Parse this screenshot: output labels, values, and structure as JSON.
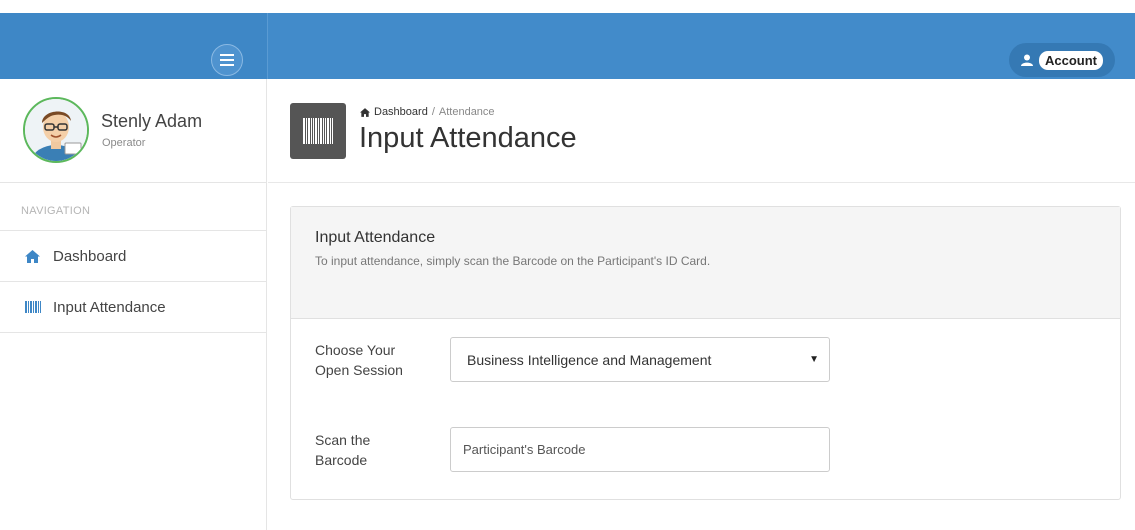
{
  "topbar": {
    "account_label": "Account",
    "colors": {
      "navbar": "#428bca",
      "sidebar_top": "#3e87c6"
    }
  },
  "sidebar": {
    "profile": {
      "name": "Stenly Adam",
      "role": "Operator"
    },
    "nav_heading": "NAVIGATION",
    "items": [
      {
        "label": "Dashboard",
        "icon": "home-icon"
      },
      {
        "label": "Input Attendance",
        "icon": "barcode-icon"
      }
    ]
  },
  "header": {
    "breadcrumb": {
      "home": "Dashboard",
      "separator": "/",
      "current": "Attendance"
    },
    "title": "Input Attendance",
    "icon": "barcode-icon"
  },
  "panel": {
    "title": "Input Attendance",
    "description": "To input attendance, simply scan the Barcode on the Participant's ID Card.",
    "session": {
      "label_line1": "Choose Your",
      "label_line2": "Open Session",
      "selected": "Business Intelligence and Management"
    },
    "barcode": {
      "label_line1": "Scan the",
      "label_line2": "Barcode",
      "placeholder": "Participant's Barcode",
      "value": ""
    }
  }
}
